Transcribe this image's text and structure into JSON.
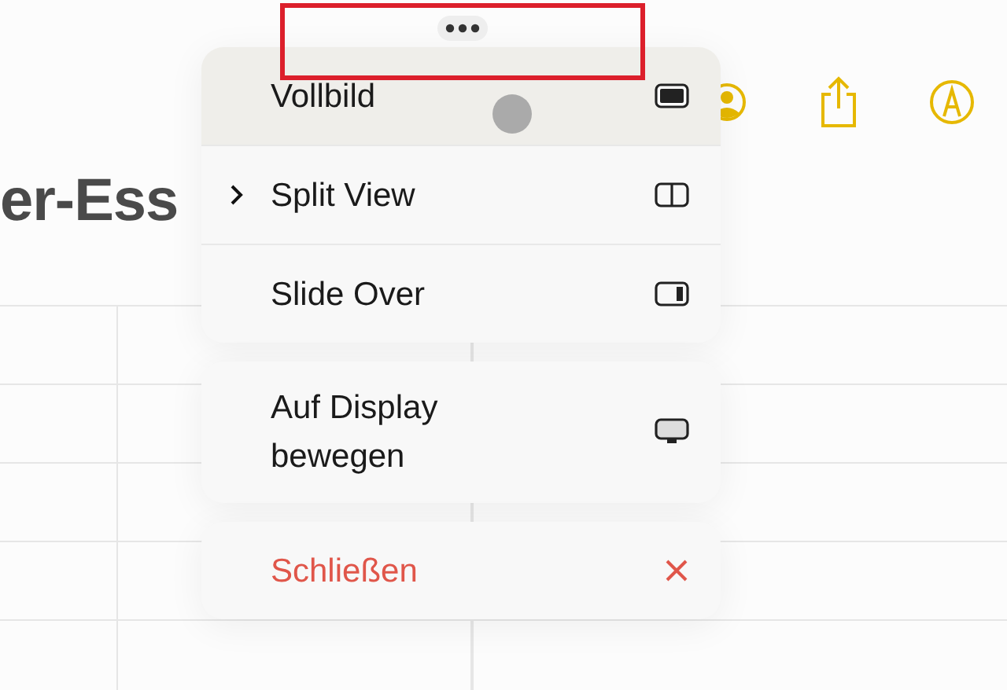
{
  "document": {
    "title_fragment": "er-Ess"
  },
  "toolbar": {
    "icons": [
      {
        "kind": "person"
      },
      {
        "kind": "share"
      },
      {
        "kind": "markup"
      }
    ]
  },
  "window_menu": {
    "groups": [
      {
        "items": [
          {
            "label": "Vollbild",
            "kind": "fullscreen",
            "selected": true,
            "has_submenu": false,
            "destructive": false
          },
          {
            "label": "Split View",
            "kind": "split",
            "selected": false,
            "has_submenu": true,
            "destructive": false
          },
          {
            "label": "Slide Over",
            "kind": "slideover",
            "selected": false,
            "has_submenu": false,
            "destructive": false
          }
        ]
      },
      {
        "items": [
          {
            "label": "Auf Display bewegen",
            "kind": "display",
            "selected": false,
            "has_submenu": false,
            "destructive": false
          }
        ]
      },
      {
        "items": [
          {
            "label": "Schließen",
            "kind": "close",
            "selected": false,
            "has_submenu": false,
            "destructive": true
          }
        ]
      }
    ]
  }
}
